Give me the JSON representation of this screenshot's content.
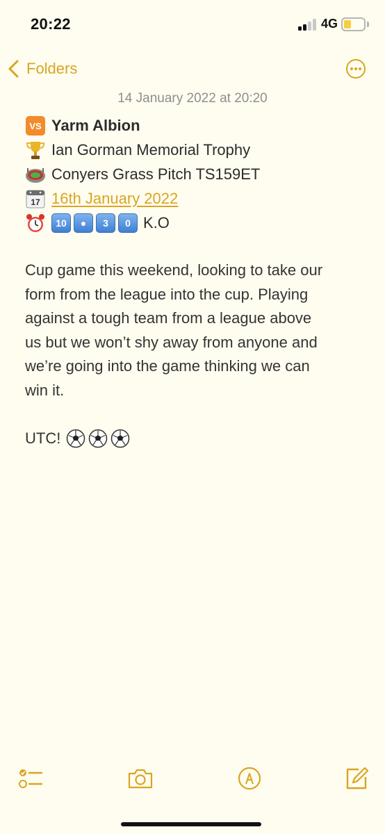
{
  "status_bar": {
    "time": "20:22",
    "network": "4G"
  },
  "nav": {
    "back_label": "Folders"
  },
  "note": {
    "date": "14 January 2022 at 20:20",
    "lines": [
      {
        "icon": "vs-icon",
        "text": "Yarm Albion"
      },
      {
        "icon": "trophy-icon",
        "text": "Ian Gorman Memorial Trophy"
      },
      {
        "icon": "stadium-icon",
        "text": "Conyers Grass Pitch TS159ET"
      },
      {
        "icon": "calendar-icon",
        "text": "16th January 2022"
      },
      {
        "icon": "alarm-clock-icon",
        "keycaps": [
          "10",
          "●",
          "3",
          "0"
        ],
        "text": "K.O"
      }
    ],
    "calendar_day": "17",
    "vs_label": "VS",
    "body_lines": [
      "Cup game this weekend, looking to take our",
      "form from the league into the cup. Playing",
      "against a tough team from a league above",
      "us but we won’t shy away from anyone and",
      "we’re going into the game thinking we can",
      "win it."
    ],
    "signoff": "UTC!",
    "signoff_icons": [
      "soccer-ball-icon",
      "soccer-ball-icon",
      "soccer-ball-icon"
    ]
  },
  "toolbar": [
    "checklist-icon",
    "camera-icon",
    "markup-icon",
    "compose-icon"
  ],
  "colors": {
    "accent": "#d9a520",
    "background": "#fffdf0",
    "text": "#2c2c2c",
    "date": "#8e8e8e"
  }
}
